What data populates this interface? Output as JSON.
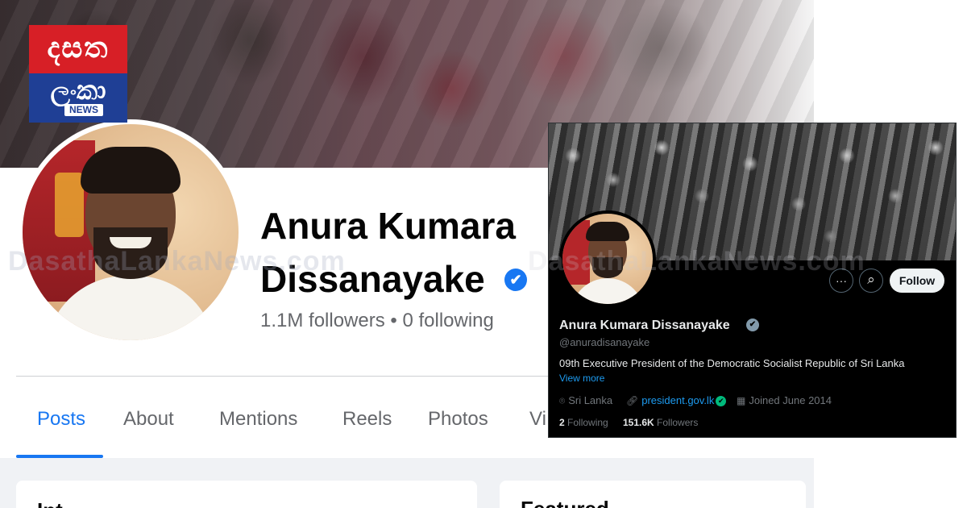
{
  "logo": {
    "line1": "දසත",
    "line2": "ලංකා",
    "badge": "NEWS"
  },
  "watermark": "DasathaLankaNews.com",
  "facebook": {
    "name_line1": "Anura Kumara",
    "name_line2": "Dissanayake",
    "verified_icon": "✔",
    "stats": "1.1M followers • 0 following",
    "tabs": [
      "Posts",
      "About",
      "Mentions",
      "Reels",
      "Photos",
      "Vi"
    ],
    "active_tab": "Posts",
    "card_left_heading": "Int",
    "card_right_heading": "Featured",
    "accent": "#1877f2"
  },
  "x_profile": {
    "name": "Anura Kumara Dissanayake",
    "handle": "@anuradisanayake",
    "bio": "09th Executive President of the Democratic Socialist Republic of Sri Lanka",
    "view_more": "View more",
    "location": "Sri Lanka",
    "website": "president.gov.lk",
    "joined": "Joined June 2014",
    "following_count": "2",
    "following_label": "Following",
    "followers_count": "151.6K",
    "followers_label": "Followers",
    "follow_button": "Follow",
    "more_icon": "···",
    "search_icon": "⌕",
    "link_accent": "#1d9bf0"
  }
}
